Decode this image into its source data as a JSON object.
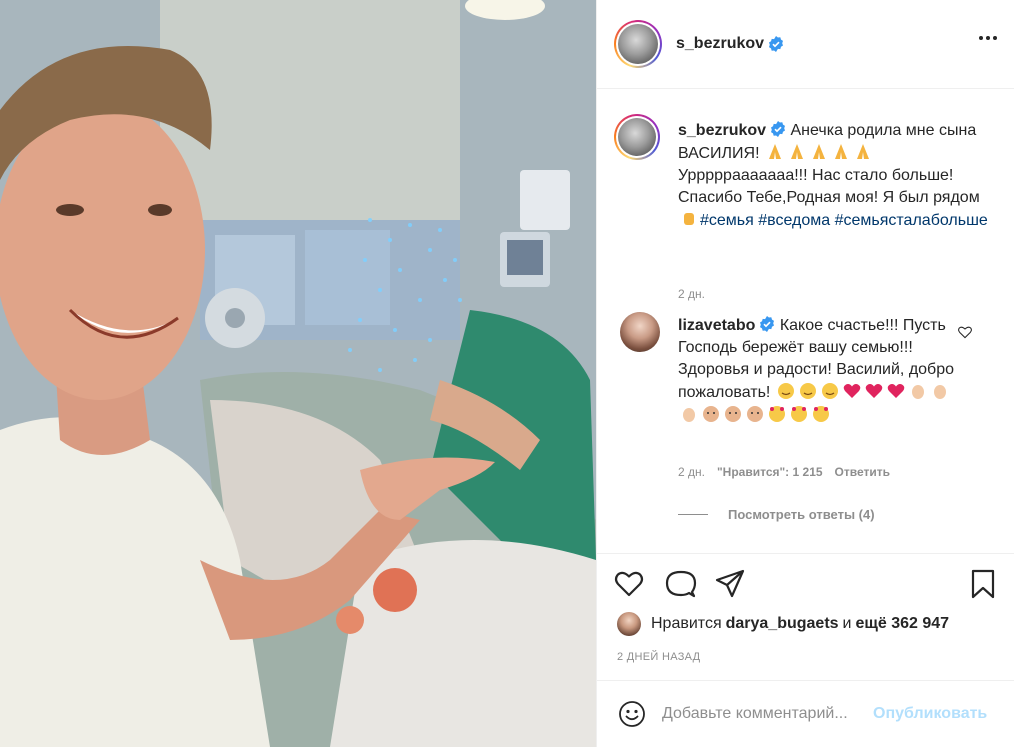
{
  "post": {
    "username": "s_bezrukov",
    "more_icon": "more-horizontal-icon"
  },
  "caption": {
    "username": "s_bezrukov",
    "text_1": "Анечка родила мне сына ВАСИЛИЯ!",
    "text_2": "Урррррааааааа!!! Нас стало больше! Спасибо Тебе,Родная моя! Я был рядом",
    "tags": [
      "#семья",
      "#вседома",
      "#семьясталабольше"
    ],
    "time": "2 дн."
  },
  "comment": {
    "username": "lizavetabo",
    "text": "Какое счастье!!! Пусть Господь бережёт вашу семью!!! Здоровья и радости! Василий, добро пожаловать!",
    "time": "2 дн.",
    "likes_label": "\"Нравится\": 1 215",
    "reply": "Ответить",
    "view_replies": "Посмотреть ответы (4)"
  },
  "actions": {
    "likes_prefix": "Нравится",
    "liker": "darya_bugaets",
    "and_more": "и",
    "more_count": "ещё 362 947",
    "date": "2 ДНЕЙ НАЗАД"
  },
  "add_comment": {
    "placeholder": "Добавьте комментарий...",
    "publish": "Опубликовать"
  },
  "colors": {
    "accent_link": "#00376b",
    "verified_blue": "#3897f0",
    "publish_disabled": "#b2dffc",
    "secondary_text": "#8e8e8e"
  }
}
